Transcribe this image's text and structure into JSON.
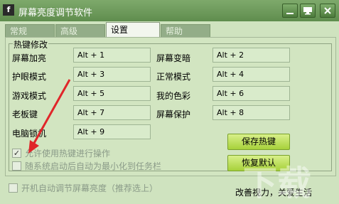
{
  "window": {
    "title": "屏幕亮度调节软件",
    "app_icon_glyph": "f"
  },
  "tabs": [
    {
      "label": "常规"
    },
    {
      "label": "高级"
    },
    {
      "label": "设置",
      "active": true
    },
    {
      "label": "帮助"
    }
  ],
  "hotkeys": {
    "group_title": "热键修改",
    "rows": [
      {
        "left_label": "屏幕加亮",
        "left_value": "Alt + 1",
        "right_label": "屏幕变暗",
        "right_value": "Alt + 2"
      },
      {
        "left_label": "护眼模式",
        "left_value": "Alt + 3",
        "right_label": "正常模式",
        "right_value": "Alt + 4"
      },
      {
        "left_label": "游戏模式",
        "left_value": "Alt + 5",
        "right_label": "我的色彩",
        "right_value": "Alt + 6"
      },
      {
        "left_label": "老板键",
        "left_value": "Alt + 7",
        "right_label": "屏幕保护",
        "right_value": "Alt + 8"
      },
      {
        "left_label": "电脑锁机",
        "left_value": "Alt + 9"
      }
    ],
    "save_button": "保存热键",
    "restore_button": "恢复默认",
    "enable_hotkeys": {
      "label": "允许使用热键进行操作",
      "checked": true
    },
    "start_minimized": {
      "label": "随系统启动后自动为最小化到任务栏",
      "checked": false
    }
  },
  "footer": {
    "auto_adjust": {
      "label": "开机自动调节屏幕亮度（推荐选上）",
      "checked": false
    },
    "slogan": "改善视力，关爱生活"
  },
  "watermark_text": "下载"
}
